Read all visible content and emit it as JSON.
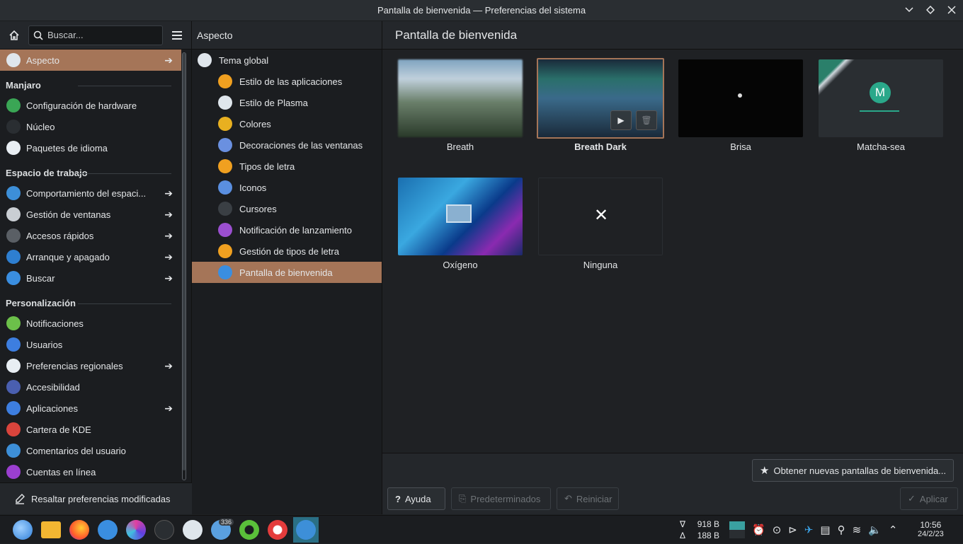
{
  "window": {
    "title": "Pantalla de bienvenida — Preferencias del sistema",
    "controls": [
      "chevron-down",
      "diamond",
      "close"
    ]
  },
  "left": {
    "search_placeholder": "Buscar...",
    "footer_label": "Resaltar preferencias modificadas",
    "items": [
      {
        "type": "item",
        "label": "Aspecto",
        "icon": "palette",
        "color": "#dfe6ec",
        "arrow": true,
        "selected": true
      },
      {
        "type": "section",
        "label": "Manjaro"
      },
      {
        "type": "item",
        "label": "Configuración de hardware",
        "icon": "hardware",
        "color": "#3aa655",
        "arrow": false
      },
      {
        "type": "item",
        "label": "Núcleo",
        "icon": "gear",
        "color": "#2a2e32",
        "arrow": false
      },
      {
        "type": "item",
        "label": "Paquetes de idioma",
        "icon": "language",
        "color": "#e8eef3",
        "arrow": false
      },
      {
        "type": "section",
        "label": "Espacio de trabajo"
      },
      {
        "type": "item",
        "label": "Comportamiento del espaci...",
        "icon": "workspace",
        "color": "#3d8fd8",
        "arrow": true
      },
      {
        "type": "item",
        "label": "Gestión de ventanas",
        "icon": "windows",
        "color": "#c9ced3",
        "arrow": true
      },
      {
        "type": "item",
        "label": "Accesos rápidos",
        "icon": "keyboard",
        "color": "#5a5f65",
        "arrow": true
      },
      {
        "type": "item",
        "label": "Arranque y apagado",
        "icon": "power",
        "color": "#2e7fd1",
        "arrow": true
      },
      {
        "type": "item",
        "label": "Buscar",
        "icon": "search",
        "color": "#3a8ee0",
        "arrow": true
      },
      {
        "type": "section",
        "label": "Personalización"
      },
      {
        "type": "item",
        "label": "Notificaciones",
        "icon": "notification",
        "color": "#6cc04a",
        "arrow": false
      },
      {
        "type": "item",
        "label": "Usuarios",
        "icon": "users",
        "color": "#3d7ee0",
        "arrow": false
      },
      {
        "type": "item",
        "label": "Preferencias regionales",
        "icon": "regional",
        "color": "#e8eef3",
        "arrow": true
      },
      {
        "type": "item",
        "label": "Accesibilidad",
        "icon": "accessibility",
        "color": "#4a5fb0",
        "arrow": false
      },
      {
        "type": "item",
        "label": "Aplicaciones",
        "icon": "apps",
        "color": "#3d7ee0",
        "arrow": true
      },
      {
        "type": "item",
        "label": "Cartera de KDE",
        "icon": "wallet",
        "color": "#d9443c",
        "arrow": false
      },
      {
        "type": "item",
        "label": "Comentarios del usuario",
        "icon": "feedback",
        "color": "#3d8fd8",
        "arrow": false
      },
      {
        "type": "item",
        "label": "Cuentas en línea",
        "icon": "accounts",
        "color": "#9b3fd0",
        "arrow": false
      }
    ]
  },
  "middle": {
    "header": "Aspecto",
    "items": [
      {
        "label": "Tema global",
        "icon": "global-theme",
        "color": "#e0e6ec",
        "top": true
      },
      {
        "label": "Estilo de las aplicaciones",
        "icon": "app-style",
        "color": "#f0a020"
      },
      {
        "label": "Estilo de Plasma",
        "icon": "plasma-style",
        "color": "#dfe6ec"
      },
      {
        "label": "Colores",
        "icon": "colors",
        "color": "#e8b020"
      },
      {
        "label": "Decoraciones de las ventanas",
        "icon": "window-decorations",
        "color": "#6a90e0"
      },
      {
        "label": "Tipos de letra",
        "icon": "fonts",
        "color": "#f0a020"
      },
      {
        "label": "Iconos",
        "icon": "icons",
        "color": "#5a8fe0"
      },
      {
        "label": "Cursores",
        "icon": "cursors",
        "color": "#3a3f44"
      },
      {
        "label": "Notificación de lanzamiento",
        "icon": "launch-feedback",
        "color": "#9b4fd0"
      },
      {
        "label": "Gestión de tipos de letra",
        "icon": "font-management",
        "color": "#f0a020"
      },
      {
        "label": "Pantalla de bienvenida",
        "icon": "splash-screen",
        "color": "#3a8ee0",
        "selected": true
      }
    ]
  },
  "right": {
    "header": "Pantalla de bienvenida",
    "themes": [
      {
        "name": "Breath",
        "style": "breath"
      },
      {
        "name": "Breath Dark",
        "style": "breathdark",
        "selected": true
      },
      {
        "name": "Brisa",
        "style": "brisa"
      },
      {
        "name": "Matcha-sea",
        "style": "matcha",
        "avatar_letter": "M"
      },
      {
        "name": "Oxígeno",
        "style": "oxygen"
      },
      {
        "name": "Ninguna",
        "style": "none"
      }
    ],
    "get_new_label": "Obtener nuevas pantallas de bienvenida...",
    "help_label": "Ayuda",
    "defaults_label": "Predeterminados",
    "reset_label": "Reiniciar",
    "apply_label": "Aplicar"
  },
  "taskbar": {
    "badge": "336",
    "net_down": "918 B",
    "net_up": "188 B",
    "down_symbol": "∇",
    "up_symbol": "Δ",
    "time": "10:56",
    "date": "24/2/23"
  }
}
